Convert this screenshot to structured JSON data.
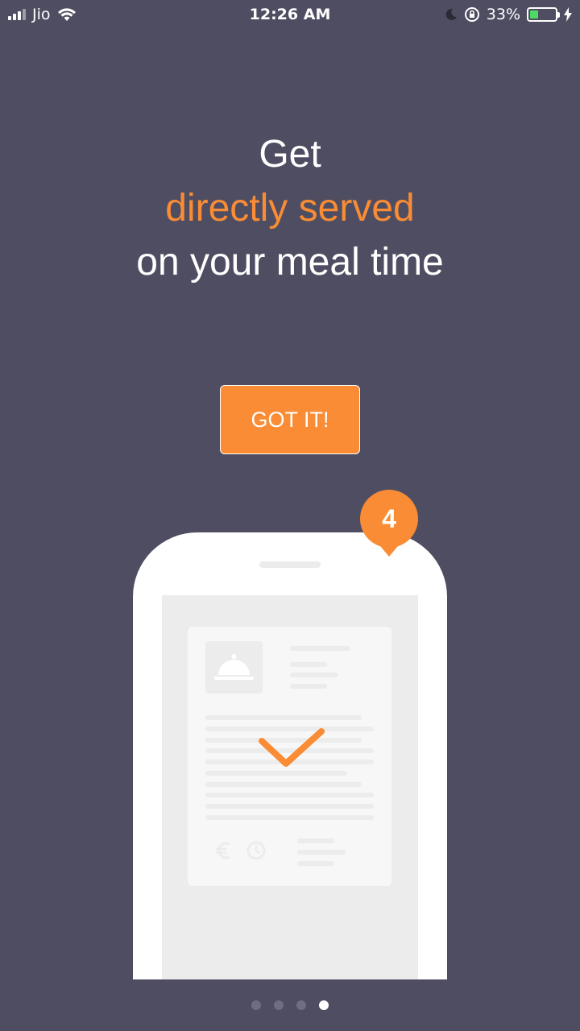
{
  "status_bar": {
    "carrier": "Jio",
    "time": "12:26 AM",
    "battery_percent": "33%",
    "battery_level": 0.33,
    "icons": [
      "signal-icon",
      "wifi-icon",
      "moon-icon",
      "rotation-lock-icon",
      "battery-icon",
      "charging-icon"
    ]
  },
  "headline": {
    "line1": "Get",
    "line2": "directly served",
    "line3": "on your meal time"
  },
  "cta": {
    "label": "GOT IT!"
  },
  "illustration": {
    "badge_number": "4",
    "icons": [
      "food-cloche-icon",
      "checkmark-icon",
      "euro-icon",
      "clock-icon"
    ]
  },
  "pager": {
    "count": 4,
    "active_index": 3
  },
  "colors": {
    "background": "#4f4d62",
    "accent": "#f98c34",
    "text": "#ffffff"
  }
}
